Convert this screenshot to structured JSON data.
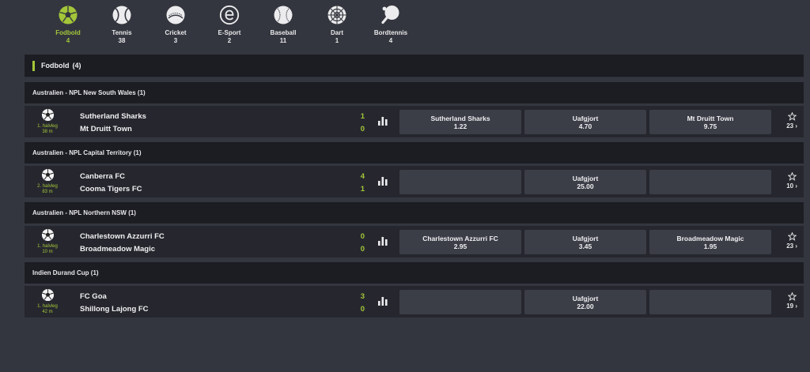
{
  "sports": [
    {
      "key": "fodbold",
      "label": "Fodbold",
      "count": "4",
      "icon": "football-icon",
      "active": true
    },
    {
      "key": "tennis",
      "label": "Tennis",
      "count": "38",
      "icon": "tennis-ball-icon",
      "active": false
    },
    {
      "key": "cricket",
      "label": "Cricket",
      "count": "3",
      "icon": "cricket-ball-icon",
      "active": false
    },
    {
      "key": "esport",
      "label": "E-Sport",
      "count": "2",
      "icon": "esport-icon",
      "active": false
    },
    {
      "key": "baseball",
      "label": "Baseball",
      "count": "11",
      "icon": "baseball-icon",
      "active": false
    },
    {
      "key": "dart",
      "label": "Dart",
      "count": "1",
      "icon": "dartboard-icon",
      "active": false
    },
    {
      "key": "bordtennis",
      "label": "Bordtennis",
      "count": "4",
      "icon": "table-tennis-icon",
      "active": false
    }
  ],
  "section": {
    "title": "Fodbold",
    "count": "(4)"
  },
  "leagues": [
    {
      "name": "Australien - NPL New South Wales (1)",
      "match": {
        "period": "1. halvleg",
        "minute": "38 m",
        "home": "Sutherland Sharks",
        "away": "Mt Druitt Town",
        "home_score": "1",
        "away_score": "0",
        "odds": [
          {
            "label": "Sutherland Sharks",
            "price": "1.22"
          },
          {
            "label": "Uafgjort",
            "price": "4.70"
          },
          {
            "label": "Mt Druitt Town",
            "price": "9.75"
          }
        ],
        "more": "23 ›"
      }
    },
    {
      "name": "Australien - NPL Capital Territory (1)",
      "match": {
        "period": "2. halvleg",
        "minute": "83 m",
        "home": "Canberra FC",
        "away": "Cooma Tigers FC",
        "home_score": "4",
        "away_score": "1",
        "odds": [
          {
            "label": "",
            "price": ""
          },
          {
            "label": "Uafgjort",
            "price": "25.00"
          },
          {
            "label": "",
            "price": ""
          }
        ],
        "more": "10 ›"
      }
    },
    {
      "name": "Australien - NPL Northern NSW (1)",
      "match": {
        "period": "1. halvleg",
        "minute": "10 m",
        "home": "Charlestown Azzurri FC",
        "away": "Broadmeadow Magic",
        "home_score": "0",
        "away_score": "0",
        "odds": [
          {
            "label": "Charlestown Azzurri FC",
            "price": "2.95"
          },
          {
            "label": "Uafgjort",
            "price": "3.45"
          },
          {
            "label": "Broadmeadow Magic",
            "price": "1.95"
          }
        ],
        "more": "23 ›"
      }
    },
    {
      "name": "Indien Durand Cup (1)",
      "match": {
        "period": "1. halvleg",
        "minute": "42 m",
        "home": "FC Goa",
        "away": "Shillong Lajong FC",
        "home_score": "3",
        "away_score": "0",
        "odds": [
          {
            "label": "",
            "price": ""
          },
          {
            "label": "Uafgjort",
            "price": "22.00"
          },
          {
            "label": "",
            "price": ""
          }
        ],
        "more": "19 ›"
      }
    }
  ],
  "colors": {
    "accent": "#a3c639",
    "background": "#34363f",
    "header": "#1c1d23",
    "row": "#26272e",
    "odd_button": "#3b3d47"
  }
}
